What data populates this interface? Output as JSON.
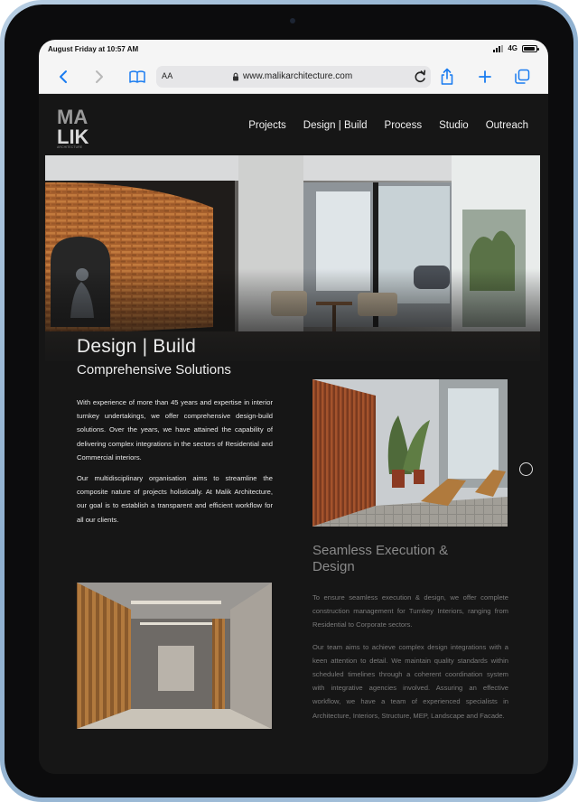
{
  "status": {
    "time": "August Friday at 10:57 AM",
    "network": "4G",
    "battery_level": 0.9
  },
  "browser": {
    "text_size_label": "AA",
    "url": "www.malikarchitecture.com",
    "icons": [
      "back-icon",
      "forward-icon",
      "bookmarks-icon",
      "lock-icon",
      "reload-icon",
      "share-icon",
      "new-tab-icon",
      "tabs-icon"
    ]
  },
  "site": {
    "logo": {
      "letters_top": "MA",
      "letters_bottom": "LIK",
      "tagline": "ARCHITECTURE"
    },
    "nav": [
      "Projects",
      "Design | Build",
      "Process",
      "Studio",
      "Outreach"
    ],
    "hero": {
      "title": "Design | Build",
      "subtitle": "Comprehensive Solutions"
    },
    "intro": {
      "p1": "With experience of more than 45 years and expertise in interior turnkey undertakings, we offer comprehensive design-build solutions. Over the years, we have attained the capability of delivering complex integrations in the sectors of Residential and Commercial interiors.",
      "p2": "Our multidisciplinary organisation aims to streamline the composite nature of projects holistically. At Malik Architecture, our goal is to establish a transparent and efficient workflow for all our clients."
    },
    "seamless": {
      "title": "Seamless Execution & Design",
      "p1": "To ensure seamless execution & design, we offer complete construction management for Turnkey Interiors, ranging from Residential to Corporate sectors.",
      "p2": "Our team aims to achieve complex design integrations with a keen attention to detail. We maintain quality standards within scheduled timelines through a coherent coordination system with integrative agencies involved. Assuring an effective workflow, we have a team of experienced specialists in Architecture, Interiors, Structure, MEP, Landscape and Facade."
    }
  }
}
